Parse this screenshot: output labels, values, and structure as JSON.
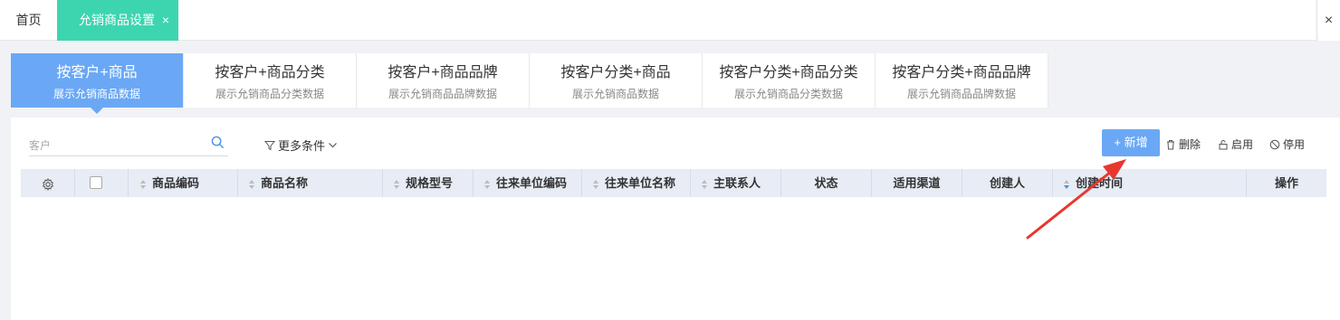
{
  "tabs": {
    "home": "首页",
    "active": "允销商品设置",
    "active_close": "×",
    "window_close": "×"
  },
  "modes": [
    {
      "title": "按客户+商品",
      "subtitle": "展示允销商品数据",
      "active": true
    },
    {
      "title": "按客户+商品分类",
      "subtitle": "展示允销商品分类数据",
      "active": false
    },
    {
      "title": "按客户+商品品牌",
      "subtitle": "展示允销商品品牌数据",
      "active": false
    },
    {
      "title": "按客户分类+商品",
      "subtitle": "展示允销商品数据",
      "active": false
    },
    {
      "title": "按客户分类+商品分类",
      "subtitle": "展示允销商品分类数据",
      "active": false
    },
    {
      "title": "按客户分类+商品品牌",
      "subtitle": "展示允销商品品牌数据",
      "active": false
    }
  ],
  "filter": {
    "search_placeholder": "客户",
    "more_conditions": "更多条件"
  },
  "toolbar": {
    "new": "+ 新增",
    "delete": "删除",
    "enable": "启用",
    "disable": "停用"
  },
  "table": {
    "columns": [
      "商品编码",
      "商品名称",
      "规格型号",
      "往来单位编码",
      "往来单位名称",
      "主联系人",
      "状态",
      "适用渠道",
      "创建人",
      "创建时间",
      "操作"
    ]
  },
  "colors": {
    "accent": "#6aa8f5",
    "active_tab": "#3dd5b0",
    "annotation_arrow": "#e8372f"
  }
}
